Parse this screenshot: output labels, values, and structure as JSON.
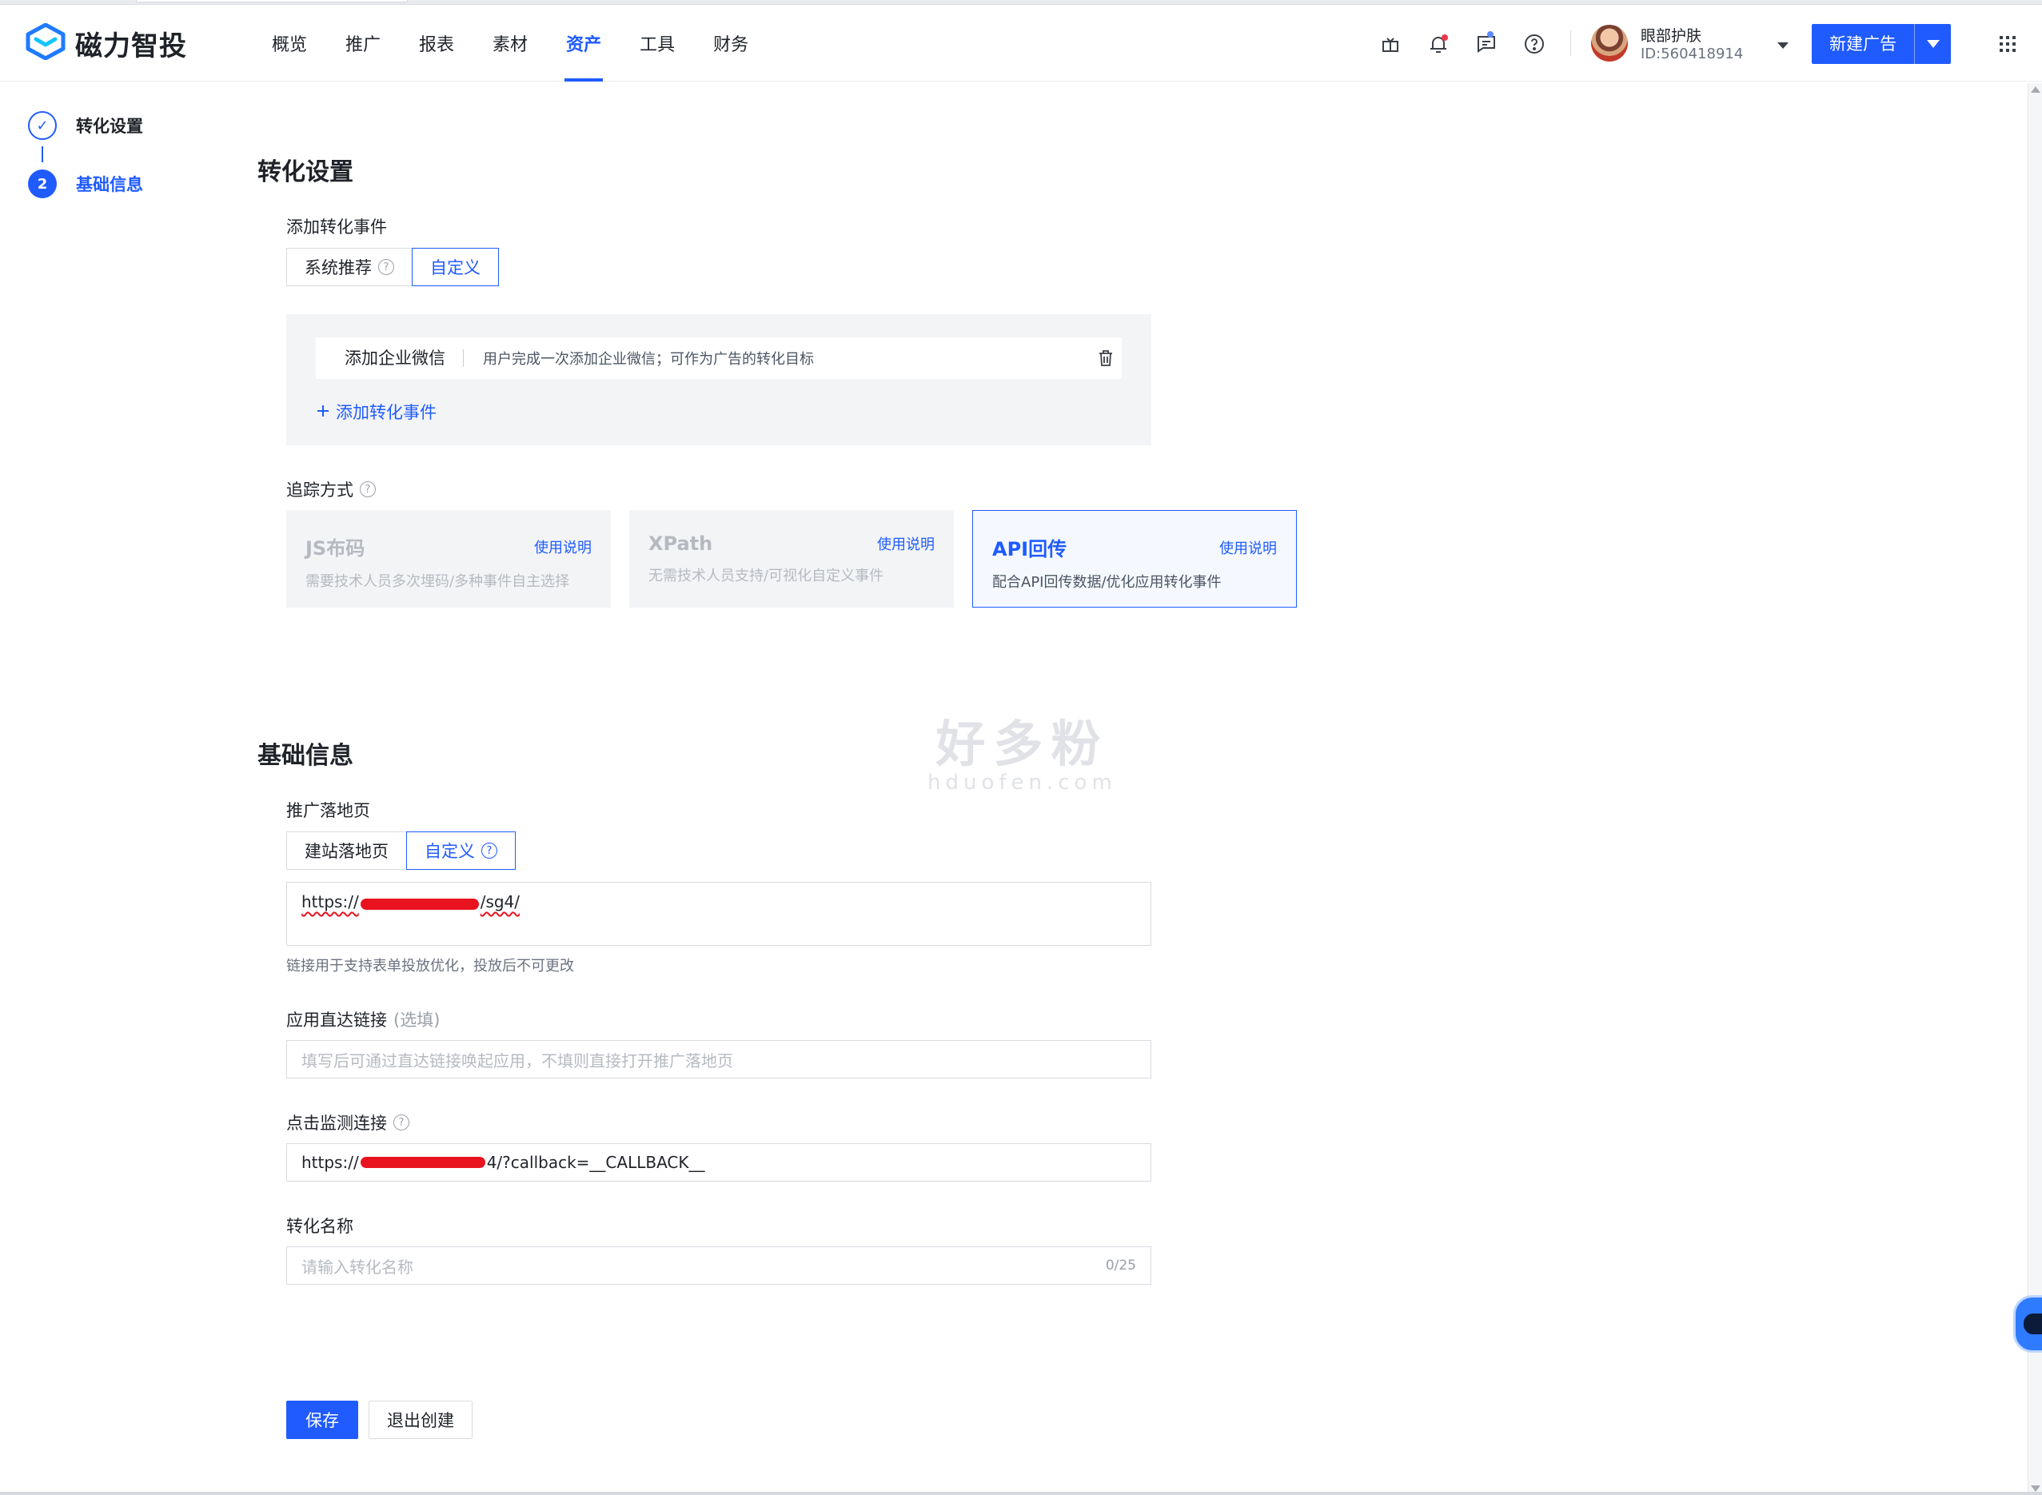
{
  "app": {
    "brand": "磁力智投",
    "nav": [
      "概览",
      "推广",
      "报表",
      "素材",
      "资产",
      "工具",
      "财务"
    ],
    "active_nav": "资产",
    "user": {
      "name": "眼部护肤",
      "id": "ID:560418914"
    },
    "new_ad_label": "新建广告",
    "accent_color": "#1f5bff"
  },
  "steps": [
    {
      "label": "转化设置",
      "marker": "✓",
      "state": "done"
    },
    {
      "label": "基础信息",
      "marker": "2",
      "state": "current"
    }
  ],
  "conversion": {
    "title": "转化设置",
    "add_event_label": "添加转化事件",
    "seg_options": [
      "系统推荐",
      "自定义"
    ],
    "seg_selected": "自定义",
    "event": {
      "name": "添加企业微信",
      "desc": "用户完成一次添加企业微信；可作为广告的转化目标"
    },
    "add_event_link": "添加转化事件",
    "tracking_label": "追踪方式",
    "tracking": [
      {
        "title": "JS布码",
        "help": "使用说明",
        "desc": "需要技术人员多次埋码/多种事件自主选择",
        "state": "disabled"
      },
      {
        "title": "XPath",
        "help": "使用说明",
        "desc": "无需技术人员支持/可视化自定义事件",
        "state": "disabled"
      },
      {
        "title": "API回传",
        "help": "使用说明",
        "desc": "配合API回传数据/优化应用转化事件",
        "state": "selected"
      }
    ]
  },
  "basic": {
    "title": "基础信息",
    "landing_label": "推广落地页",
    "landing_options": [
      "建站落地页",
      "自定义"
    ],
    "landing_selected": "自定义",
    "landing_url_prefix": "https://",
    "landing_url_suffix": "/sg4/",
    "landing_hint": "链接用于支持表单投放优化，投放后不可更改",
    "deeplink_label": "应用直达链接",
    "deeplink_optional": "(选填)",
    "deeplink_placeholder": "填写后可通过直达链接唤起应用，不填则直接打开推广落地页",
    "monitor_label": "点击监测连接",
    "monitor_url_prefix": "https://",
    "monitor_url_suffix": "4/?callback=__CALLBACK__",
    "conv_name_label": "转化名称",
    "conv_name_placeholder": "请输入转化名称",
    "conv_name_counter": "0/25"
  },
  "actions": {
    "save": "保存",
    "exit": "退出创建"
  },
  "watermark": {
    "main": "好多粉",
    "sub": "hduofen.com"
  },
  "icons": [
    "logo-icon",
    "gift-icon",
    "bell-icon",
    "message-icon",
    "help-icon",
    "caret-down-icon",
    "apps-grid-icon",
    "check-icon",
    "question-icon",
    "trash-icon",
    "plus-icon"
  ]
}
